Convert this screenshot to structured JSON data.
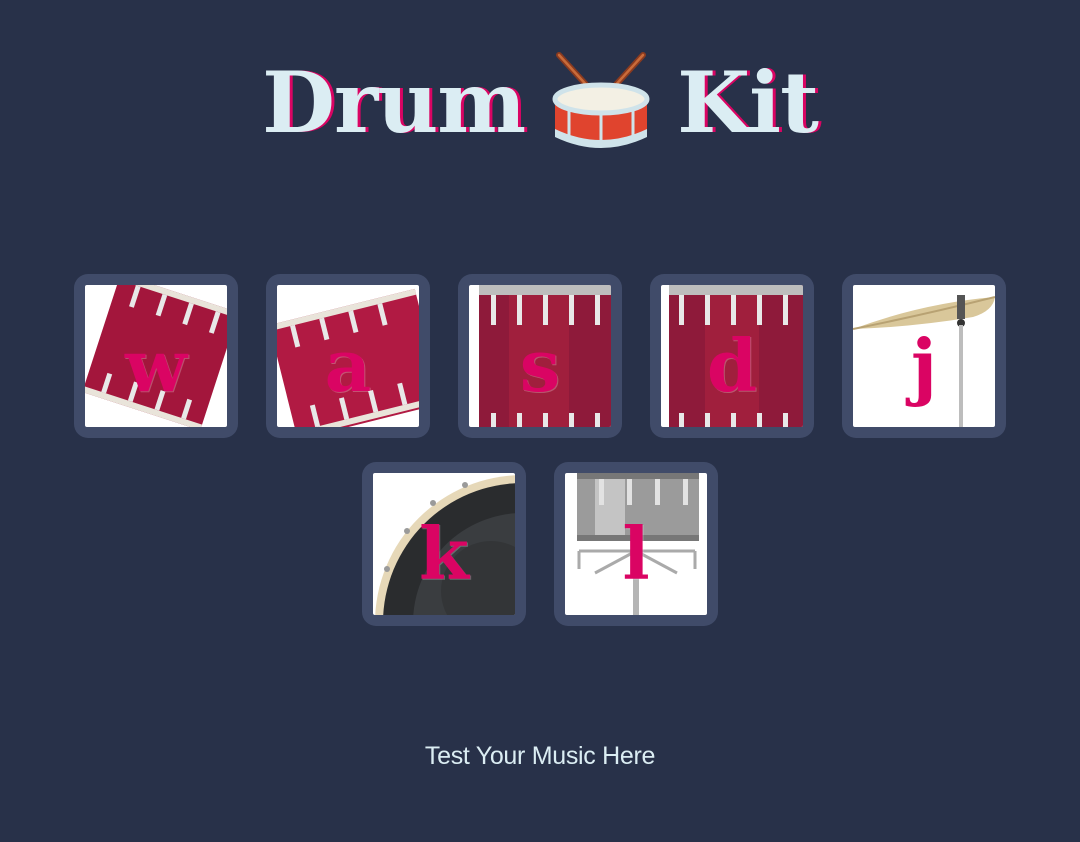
{
  "header": {
    "title_left": "Drum",
    "title_icon": "drum-emoji-icon",
    "title_right": "Kit"
  },
  "pads": [
    {
      "key": "w",
      "instrument_icon": "tom-1-icon"
    },
    {
      "key": "a",
      "instrument_icon": "tom-2-icon"
    },
    {
      "key": "s",
      "instrument_icon": "tom-3-icon"
    },
    {
      "key": "d",
      "instrument_icon": "tom-4-icon"
    },
    {
      "key": "j",
      "instrument_icon": "crash-cymbal-icon"
    },
    {
      "key": "k",
      "instrument_icon": "kick-drum-icon"
    },
    {
      "key": "l",
      "instrument_icon": "snare-drum-icon"
    }
  ],
  "footer": {
    "text": "Test Your Music Here"
  },
  "colors": {
    "background": "#283149",
    "pad_frame": "#404B69",
    "accent": "#DA0463",
    "title_text": "#DBEDF3"
  }
}
